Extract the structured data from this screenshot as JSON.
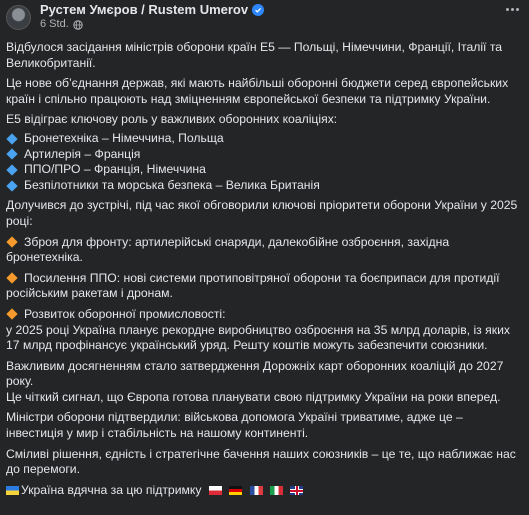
{
  "post": {
    "author": "Рустем Умєров / Rustem Umerov",
    "time": "6 Std.",
    "icons": {
      "verified": "verified-badge-icon",
      "privacy": "globe-icon",
      "menu": "more-options-icon"
    },
    "paragraphs": {
      "p1": "Відбулося засідання міністрів оборони країн Е5 — Польщі, Німеччини, Франції, Італії та Великобританії.",
      "p2": "Це нове об’єднання держав, які мають найбільші оборонні бюджети серед європейських країн і спільно працюють над зміцненням європейської безпеки та підтримку України.",
      "p3": "Е5 відіграє ключову роль у важливих оборонних коаліціях:",
      "coalitions": [
        "Бронетехніка – Німеччина, Польща",
        "Артилерія – Франція",
        "ППО/ПРО – Франція, Німеччина",
        "Безпілотники та морська безпека – Велика Британія"
      ],
      "p4": "Долучився до зустрічі, під час якої обговорили ключові пріоритети оборони України у 2025 році:",
      "priority1": "Зброя для фронту: артилерійські снаряди, далекобійне озброєння, західна бронетехніка.",
      "priority2": "Посилення ППО: нові системи протиповітряної оборони та боєприпаси для протидії російським ракетам і дронам.",
      "priority3_head": "Розвиток оборонної промисловості:",
      "priority3_body": "у 2025 році Україна планує рекордне виробництво озброєння на 35 млрд доларів, із яких 17 млрд профінансує український уряд. Решту коштів можуть забезпечити союзники.",
      "p5": "Важливим досягненням стало затвердження Дорожніх карт оборонних коаліцій до 2027 року.",
      "p6": "Це чіткий сигнал, що Європа готова планувати свою підтримку України на роки вперед.",
      "p7": "Міністри оборони підтвердили: військова допомога Україні триватиме, адже це – інвестиція у мир і стабільність на нашому континенті.",
      "p8": "Сміливі рішення, єдність і стратегічне бачення наших союзників – це те, що наближає нас до перемоги.",
      "p9": "Україна вдячна за цю підтримку"
    }
  }
}
